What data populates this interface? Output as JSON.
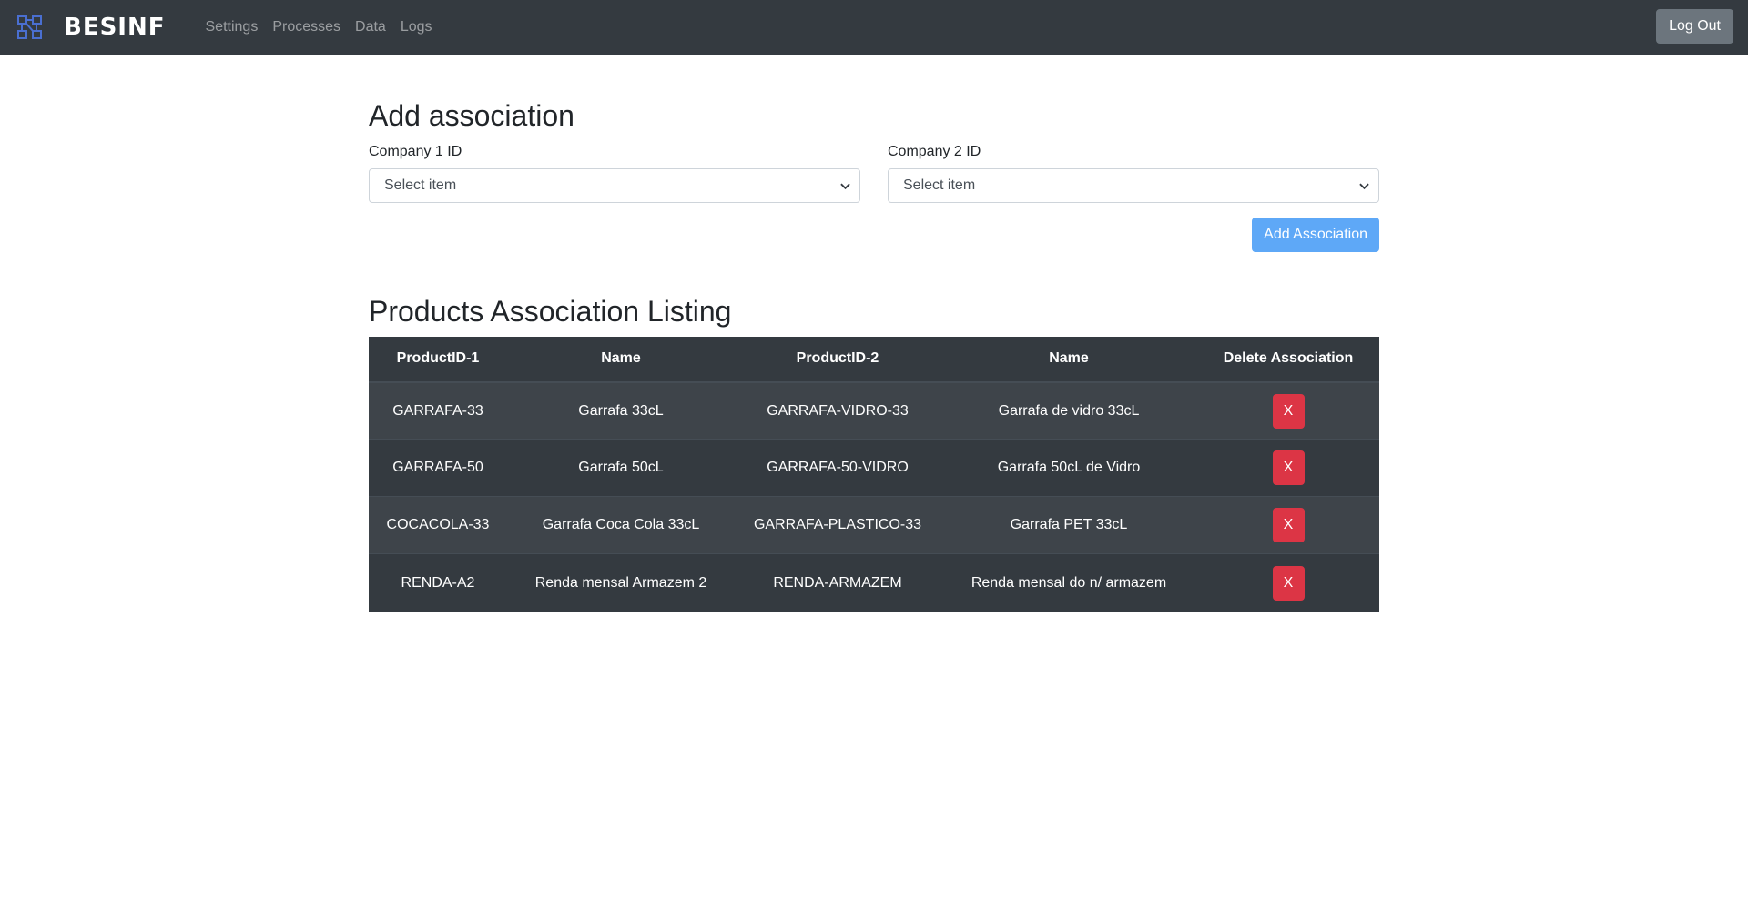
{
  "navbar": {
    "brand": "BESINF",
    "logo_icon": "network-nodes-icon",
    "links": [
      "Settings",
      "Processes",
      "Data",
      "Logs"
    ],
    "logout_label": "Log Out"
  },
  "add_section": {
    "title": "Add association",
    "company1": {
      "label": "Company 1 ID",
      "selected": "Select item"
    },
    "company2": {
      "label": "Company 2 ID",
      "selected": "Select item"
    },
    "add_button": "Add Association"
  },
  "listing": {
    "title": "Products Association Listing",
    "columns": [
      "ProductID-1",
      "Name",
      "ProductID-2",
      "Name",
      "Delete Association"
    ],
    "rows": [
      {
        "product1": "GARRAFA-33",
        "name1": "Garrafa 33cL",
        "product2": "GARRAFA-VIDRO-33",
        "name2": "Garrafa de vidro 33cL",
        "delete": "X"
      },
      {
        "product1": "GARRAFA-50",
        "name1": "Garrafa 50cL",
        "product2": "GARRAFA-50-VIDRO",
        "name2": "Garrafa 50cL de Vidro",
        "delete": "X"
      },
      {
        "product1": "COCACOLA-33",
        "name1": "Garrafa Coca Cola 33cL",
        "product2": "GARRAFA-PLASTICO-33",
        "name2": "Garrafa PET 33cL",
        "delete": "X"
      },
      {
        "product1": "RENDA-A2",
        "name1": "Renda mensal Armazem 2",
        "product2": "RENDA-ARMAZEM",
        "name2": "Renda mensal do n/ armazem",
        "delete": "X"
      }
    ]
  },
  "colors": {
    "navbar_bg": "#343a40",
    "primary_button": "#5ea8f7",
    "danger_button": "#dc3545",
    "secondary_button": "#6c757d"
  }
}
